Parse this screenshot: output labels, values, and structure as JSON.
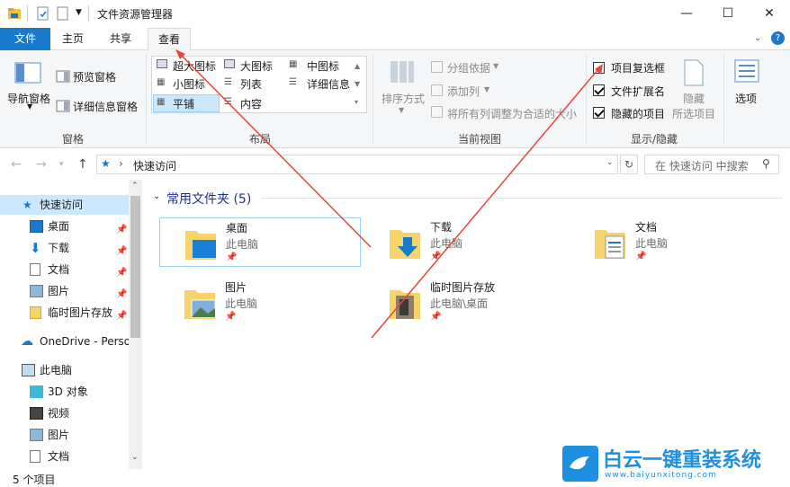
{
  "window": {
    "title": "文件资源管理器",
    "controls": [
      "—",
      "☐",
      "✕"
    ]
  },
  "ribbon_tabs": [
    "文件",
    "主页",
    "共享",
    "查看"
  ],
  "ribbon": {
    "pane_group": {
      "nav_pane": "导航窗格",
      "preview_pane": "预览窗格",
      "details_pane": "详细信息窗格",
      "label": "窗格"
    },
    "layout_group": {
      "items": [
        "超大图标",
        "大图标",
        "中图标",
        "小图标",
        "列表",
        "详细信息",
        "平铺",
        "内容"
      ],
      "selected": "平铺",
      "label": "布局"
    },
    "current_view_group": {
      "sort_by": "排序方式",
      "group_by": "分组依据",
      "add_columns": "添加列",
      "fit_columns": "将所有列调整为合适的大小",
      "label": "当前视图"
    },
    "show_hide_group": {
      "item_checkboxes": {
        "label": "项目复选框",
        "checked": false
      },
      "file_extensions": {
        "label": "文件扩展名",
        "checked": true
      },
      "hidden_items": {
        "label": "隐藏的项目",
        "checked": true
      },
      "hide_selected": "隐藏",
      "hide_selected_2": "所选项目",
      "label": "显示/隐藏"
    },
    "options": "选项"
  },
  "address": {
    "path": "快速访问",
    "search_placeholder": "在 快速访问 中搜索"
  },
  "nav_pane": {
    "quick_access": "快速访问",
    "quick_items": [
      "桌面",
      "下载",
      "文档",
      "图片",
      "临时图片存放"
    ],
    "onedrive": "OneDrive - Perso",
    "this_pc": "此电脑",
    "pc_items": [
      "3D 对象",
      "视频",
      "图片",
      "文档"
    ]
  },
  "content": {
    "group_header": "常用文件夹 (5)",
    "folders": [
      {
        "name": "桌面",
        "location": "此电脑"
      },
      {
        "name": "下载",
        "location": "此电脑"
      },
      {
        "name": "文档",
        "location": "此电脑"
      },
      {
        "name": "图片",
        "location": "此电脑"
      },
      {
        "name": "临时图片存放",
        "location": "此电脑\\桌面"
      }
    ]
  },
  "status": {
    "item_count": "5 个项目"
  },
  "watermark": {
    "brand": "白云一键重装系统",
    "url": "www.baiyunxitong.com"
  },
  "colors": {
    "accent": "#1979ca",
    "arrow": "#e8453c",
    "selection": "#cce8ff"
  }
}
